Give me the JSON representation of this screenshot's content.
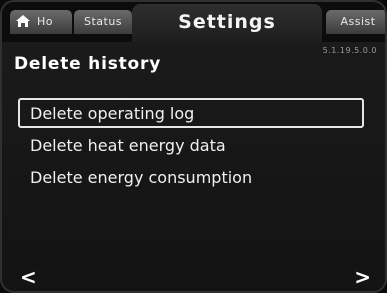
{
  "tabs": {
    "home_label": "Ho",
    "status_label": "Status",
    "settings_label": "Settings",
    "assist_label": "Assist"
  },
  "version": "5.1.19.5.0.0",
  "page_title": "Delete history",
  "menu": {
    "items": [
      {
        "label": "Delete operating log",
        "selected": true
      },
      {
        "label": "Delete heat energy data",
        "selected": false
      },
      {
        "label": "Delete energy consumption",
        "selected": false
      }
    ]
  },
  "nav": {
    "left_icon": "chevron-left-icon",
    "right_icon": "chevron-right-icon",
    "left_glyph": "<",
    "right_glyph": ">"
  },
  "colors": {
    "selection_border": "#e6e6e6",
    "tab_bg": "#5a5a5a",
    "screen_bg": "#1a1a1a"
  }
}
